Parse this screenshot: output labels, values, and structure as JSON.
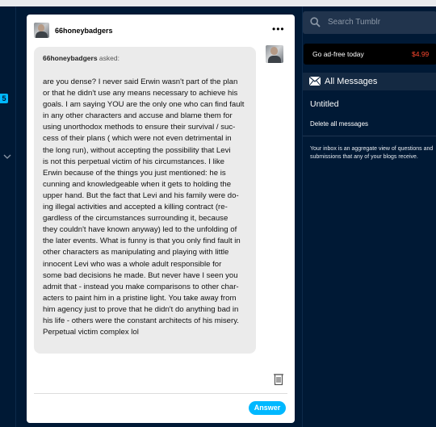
{
  "left_rail": {
    "badge": "5"
  },
  "post": {
    "author": "66honeybadgers",
    "menu": "•••",
    "asker": "66honeybadgers",
    "asked_suffix": " asked:",
    "question": "are you dense? I never said Erwin wasn't part of the plan\nor that he didn't use any means necessary to achieve his\ngoals. I am saying YOU are the only one who can find fault\nin any other characters and accuse and blame them for\nusing unorthodox methods to ensure their survival / suc-\ncess of their plans ( which were not even detrimental in\nthe long run), without accepting the possibility that Levi\nis not this perpetual victim of his circumstances. I like\nErwin because of the things you just mentioned: he is\ncunning and knowledgeable when it gets to holding the\nupper hand. But the fact that Levi and his family were do-\ning illegal activities and accepted a killing contract (re-\ngardless of the circumstances surrounding it, because\nthey couldn't have known anyway) led to the unfolding of\nthe later events. What is funny is that you only find fault in\nother characters as manipulating and playing with little\ninnocent Levi who was a whole adult responsible for\nsome bad decisions he made. But never have I seen you\nadmit that - instead you make comparisons to other char-\nacters to paint him in a pristine light. You take away from\nhim agency just to prove that he didn't do anything bad in\nhis life - others were the constant architects of his misery.\nPerpetual victim complex lol",
    "answer_label": "Answer"
  },
  "sidebar": {
    "search_placeholder": "Search Tumblr",
    "adfree_label": "Go ad-free today",
    "adfree_price": "$4.99",
    "messages_label": "All Messages",
    "inbox_title": "Untitled",
    "delete_all": "Delete all messages",
    "inbox_note": "Your inbox is an aggregate view of questions and submissions that any of your blogs receive."
  },
  "colors": {
    "background": "#001935",
    "accent": "#00b8ff",
    "price": "#ff4930"
  }
}
